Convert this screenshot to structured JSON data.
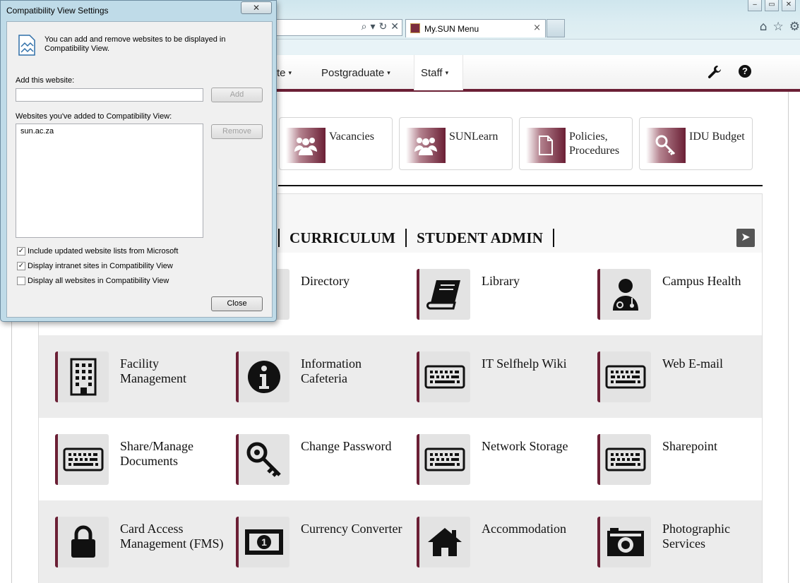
{
  "browser": {
    "window_buttons": [
      "‒",
      "▭",
      "✕"
    ],
    "address_icons": [
      "⌕",
      "▾",
      "↻",
      "✕"
    ],
    "active_tab": {
      "title": "My.SUN Menu",
      "close": "×"
    },
    "toolbar_icons": [
      "⌂",
      "☆",
      "⚙"
    ]
  },
  "site": {
    "nav": [
      {
        "label": "te",
        "caret": "▾"
      },
      {
        "label": "Postgraduate",
        "caret": "▾"
      },
      {
        "label": "Staff",
        "caret": "▾"
      }
    ],
    "help_symbol": "?",
    "quick_links": [
      {
        "label": "Vacancies",
        "icon": "people-icon"
      },
      {
        "label": "SUNLearn",
        "icon": "people-icon"
      },
      {
        "label": "Policies, Procedures",
        "icon": "document-icon"
      },
      {
        "label": "IDU Budget",
        "icon": "key-icon"
      }
    ],
    "tabs": [
      "CURRICULUM",
      "STUDENT ADMIN"
    ],
    "tabs_next_symbol": "➤",
    "services": [
      {
        "label": "Directory",
        "icon": "directory-icon"
      },
      {
        "label": "Library",
        "icon": "book-icon"
      },
      {
        "label": "Campus Health",
        "icon": "doctor-icon"
      },
      {
        "label": "Facility Management",
        "icon": "building-icon"
      },
      {
        "label": "Information Cafeteria",
        "icon": "info-icon"
      },
      {
        "label": "IT Selfhelp Wiki",
        "icon": "keyboard-icon"
      },
      {
        "label": "Web E-mail",
        "icon": "keyboard-icon"
      },
      {
        "label": "Share/Manage Documents",
        "icon": "keyboard-icon"
      },
      {
        "label": "Change Password",
        "icon": "key-icon"
      },
      {
        "label": "Network Storage",
        "icon": "keyboard-icon"
      },
      {
        "label": "Sharepoint",
        "icon": "keyboard-icon"
      },
      {
        "label": "Card Access Management (FMS)",
        "icon": "lock-icon"
      },
      {
        "label": "Currency Converter",
        "icon": "banknote-icon"
      },
      {
        "label": "Accommodation",
        "icon": "house-icon"
      },
      {
        "label": "Photographic Services",
        "icon": "camera-icon"
      }
    ],
    "colors": {
      "accent": "#6b1f35",
      "tile_bg": "#e3e3e3",
      "band_alt": "#ececec"
    }
  },
  "dialog": {
    "title": "Compatibility View Settings",
    "close_symbol": "✕",
    "intro": "You can add and remove websites to be displayed in Compatibility View.",
    "add_label": "Add this website:",
    "add_value": "",
    "add_button": "Add",
    "list_label": "Websites you've added to Compatibility View:",
    "list_items": [
      "sun.ac.za"
    ],
    "remove_button": "Remove",
    "checkboxes": [
      {
        "label": "Include updated website lists from Microsoft",
        "checked": true
      },
      {
        "label": "Display intranet sites in Compatibility View",
        "checked": true
      },
      {
        "label": "Display all websites in Compatibility View",
        "checked": false
      }
    ],
    "close_button": "Close"
  }
}
